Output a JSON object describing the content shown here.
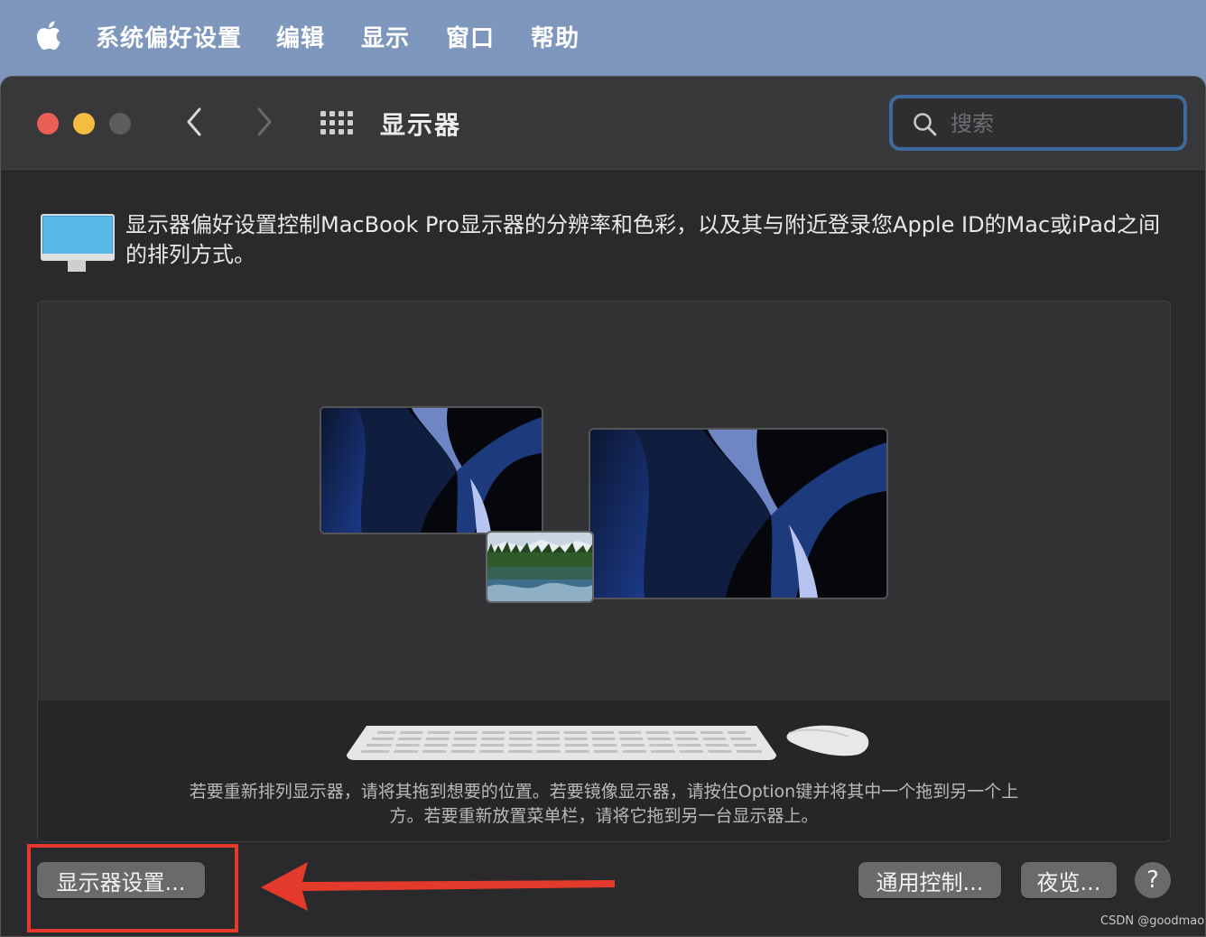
{
  "menubar": {
    "app_name": "系统偏好设置",
    "items": [
      "编辑",
      "显示",
      "窗口",
      "帮助"
    ]
  },
  "window": {
    "title": "显示器",
    "search_placeholder": "搜索"
  },
  "description": "显示器偏好设置控制MacBook Pro显示器的分辨率和色彩，以及其与附近登录您Apple ID的Mac或iPad之间的排列方式。",
  "arrangement_hint": {
    "line1": "若要重新排列显示器，请将其拖到想要的位置。若要镜像显示器，请按住Option键并将其中一个拖到另一个上",
    "line2": "方。若要重新放置菜单栏，请将它拖到另一台显示器上。"
  },
  "buttons": {
    "display_settings": "显示器设置...",
    "universal_control": "通用控制...",
    "night_shift": "夜览...",
    "help": "?"
  },
  "watermark": "CSDN @goodmao",
  "colors": {
    "close": "#ec5f56",
    "minimize": "#f4bd3f",
    "zoom_inactive": "#5d5d60",
    "search_focus": "#3e6b9e",
    "annotation_red": "#e43a2b"
  }
}
